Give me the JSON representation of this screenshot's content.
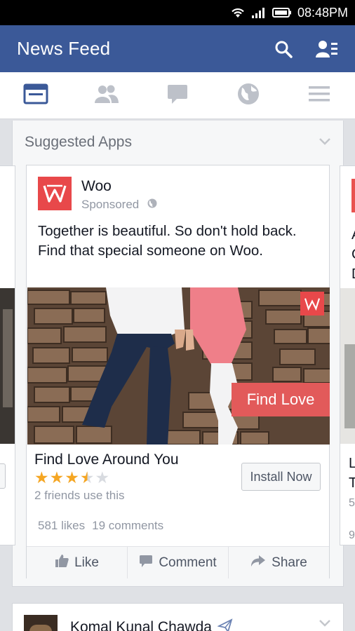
{
  "status_bar": {
    "time": "08:48PM",
    "icons": [
      "wifi-icon",
      "signal-icon",
      "battery-icon"
    ]
  },
  "header": {
    "title": "News Feed",
    "icons": [
      "search-icon",
      "friend-requests-icon"
    ]
  },
  "tabs": [
    {
      "name": "news-feed",
      "icon": "news-feed-icon",
      "active": true
    },
    {
      "name": "friends",
      "icon": "friends-icon",
      "active": false
    },
    {
      "name": "messages",
      "icon": "messages-icon",
      "active": false
    },
    {
      "name": "notifications",
      "icon": "globe-icon",
      "active": false
    },
    {
      "name": "more",
      "icon": "menu-icon",
      "active": false
    }
  ],
  "suggested": {
    "title": "Suggested Apps",
    "card": {
      "app_name": "Woo",
      "sponsored": "Sponsored",
      "description": "Together is beautiful. So don't hold back. Find that special someone on Woo.",
      "image_overlay_text": "Find Love",
      "cta_title": "Find Love Around You",
      "rating": 3.5,
      "stars_max": 5,
      "friends_text": "2 friends use this",
      "install_label": "Install Now",
      "likes": "581 likes",
      "comments": "19 comments",
      "actions": {
        "like": "Like",
        "comment": "Comment",
        "share": "Share"
      }
    },
    "right_peek": {
      "line1": "A",
      "line2": "C",
      "line3": "D",
      "cta1": "L",
      "cta2": "T",
      "friends": "5",
      "counts": "9"
    }
  },
  "next_post": {
    "author": "Komal Kunal Chawda"
  },
  "colors": {
    "brand_blue": "#3b5998",
    "woo_red": "#e8484a",
    "star_gold": "#f5a623"
  }
}
